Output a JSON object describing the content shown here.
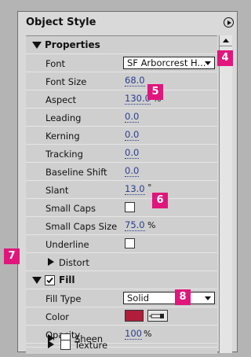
{
  "panel": {
    "title": "Object Style"
  },
  "properties_section": {
    "label": "Properties"
  },
  "rows": {
    "font": {
      "label": "Font",
      "value": "SF Arborcrest H..."
    },
    "font_size": {
      "label": "Font Size",
      "value": "68.0"
    },
    "aspect": {
      "label": "Aspect",
      "value": "130.0",
      "unit": "%"
    },
    "leading": {
      "label": "Leading",
      "value": "0.0"
    },
    "kerning": {
      "label": "Kerning",
      "value": "0.0"
    },
    "tracking": {
      "label": "Tracking",
      "value": "0.0"
    },
    "baseline_shift": {
      "label": "Baseline Shift",
      "value": "0.0"
    },
    "slant": {
      "label": "Slant",
      "value": "13.0",
      "unit": "°"
    },
    "small_caps": {
      "label": "Small Caps",
      "checked": false
    },
    "small_caps_size": {
      "label": "Small Caps Size",
      "value": "75.0",
      "unit": "%"
    },
    "underline": {
      "label": "Underline",
      "checked": false
    },
    "distort": {
      "label": "Distort"
    }
  },
  "fill_section": {
    "label": "Fill",
    "checked": true,
    "fill_type": {
      "label": "Fill Type",
      "value": "Solid"
    },
    "color": {
      "label": "Color",
      "swatch": "#b01e3c"
    },
    "opacity": {
      "label": "Opacity",
      "value": "100",
      "unit": "%"
    },
    "sheen": {
      "label": "Sheen",
      "checked": false
    },
    "texture": {
      "label": "Texture",
      "checked": false
    }
  },
  "callouts": [
    "4",
    "5",
    "6",
    "7",
    "8"
  ],
  "colors": {
    "callout": "#e0167c",
    "value_text": "#2a3e8f"
  }
}
